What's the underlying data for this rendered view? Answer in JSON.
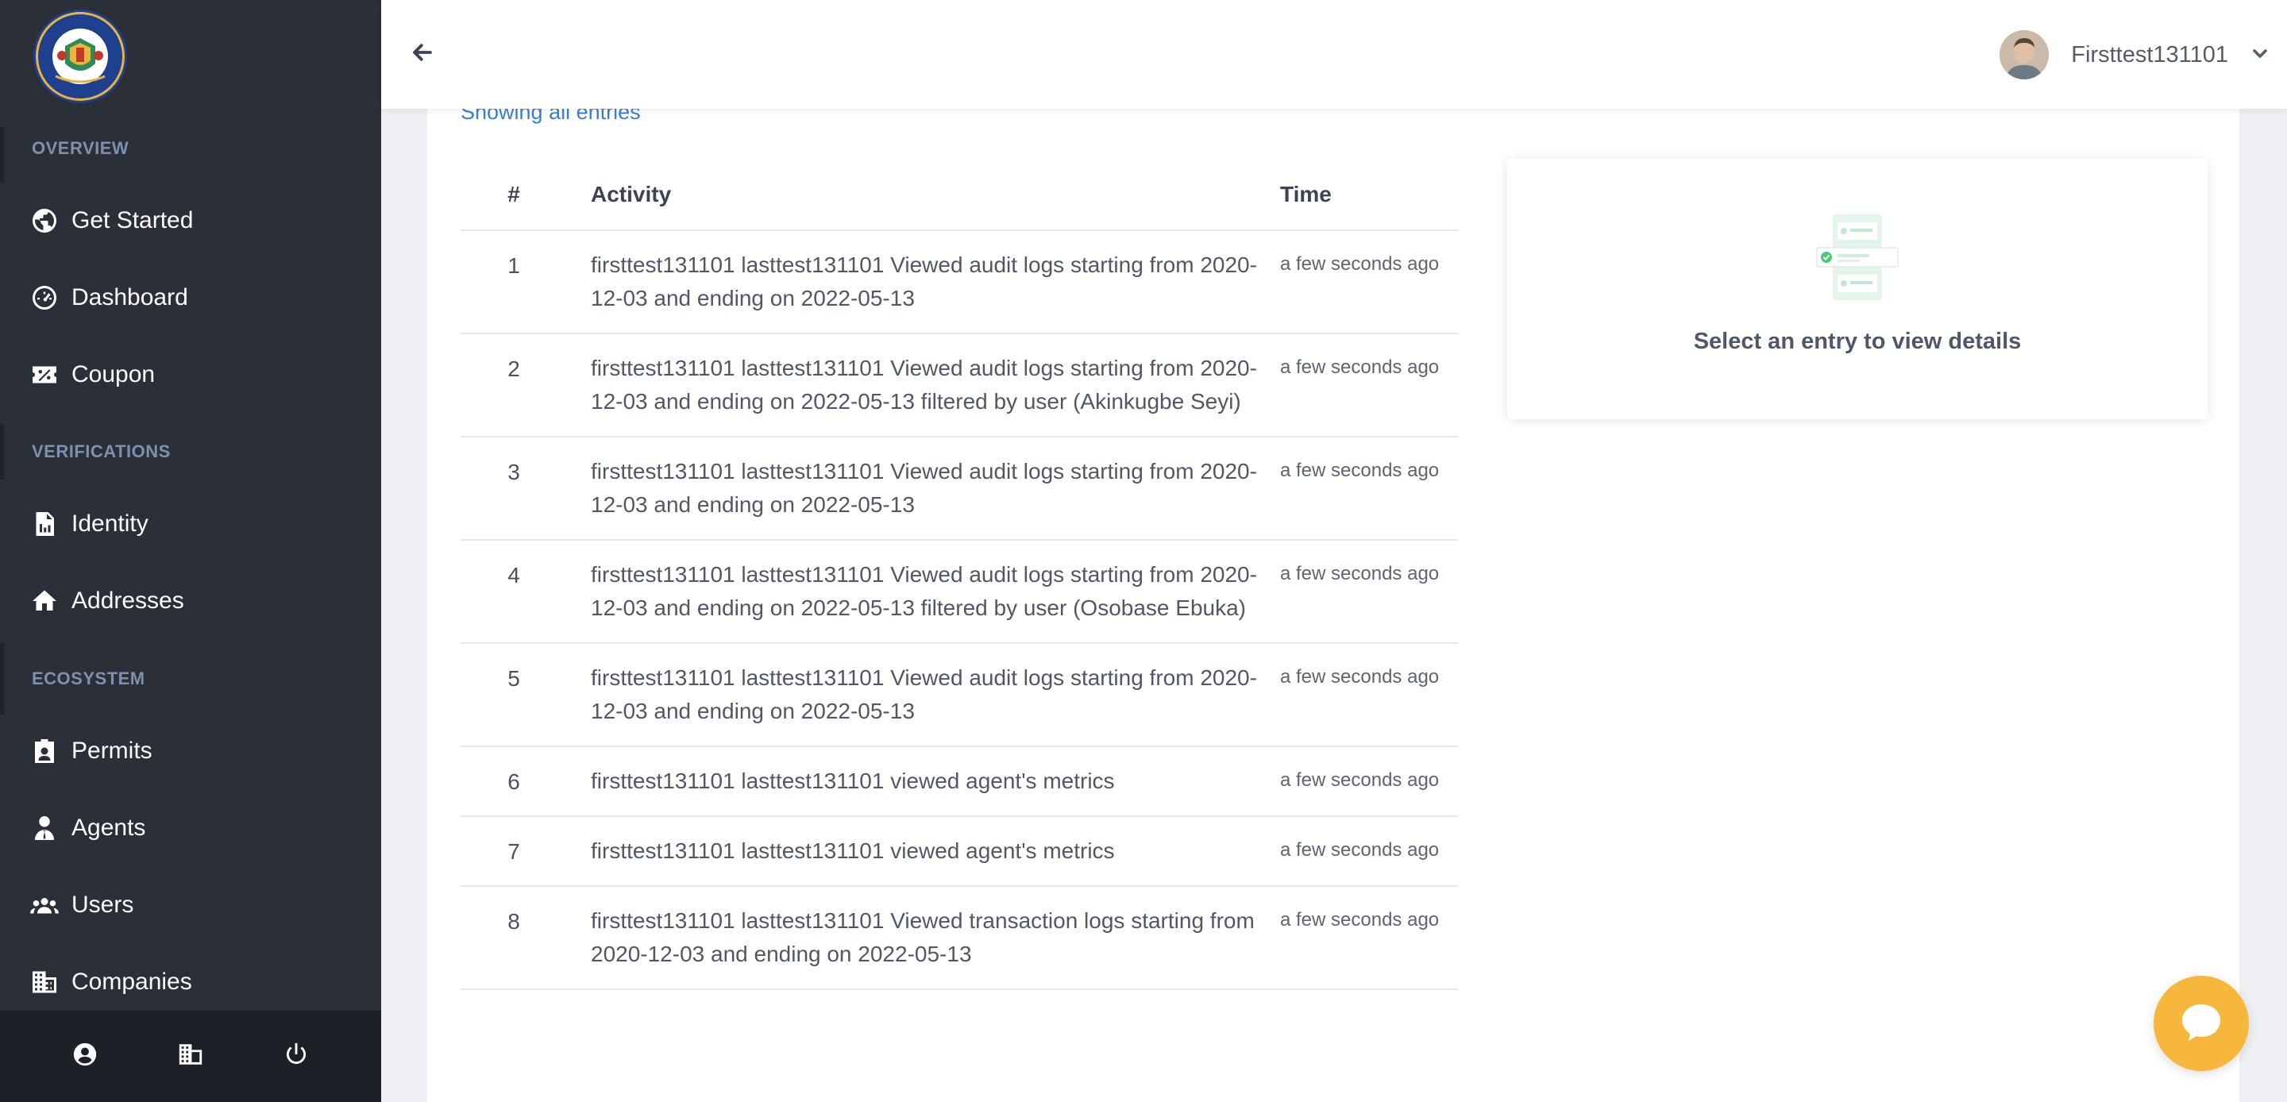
{
  "sidebar": {
    "logo_text": "LAGOS STATE LOTTERIES AND GAMING AUTHORITY",
    "sections": [
      {
        "label": "OVERVIEW"
      },
      {
        "label": "VERIFICATIONS"
      },
      {
        "label": "ECOSYSTEM"
      }
    ],
    "items": [
      {
        "label": "Get Started",
        "icon": "globe-icon"
      },
      {
        "label": "Dashboard",
        "icon": "gauge-icon"
      },
      {
        "label": "Coupon",
        "icon": "coupon-icon"
      },
      {
        "label": "Identity",
        "icon": "id-document-icon"
      },
      {
        "label": "Addresses",
        "icon": "home-icon"
      },
      {
        "label": "Permits",
        "icon": "badge-icon"
      },
      {
        "label": "Agents",
        "icon": "agent-icon"
      },
      {
        "label": "Users",
        "icon": "users-icon"
      },
      {
        "label": "Companies",
        "icon": "building-icon"
      }
    ],
    "footer": [
      "profile-icon",
      "company-icon",
      "power-icon"
    ]
  },
  "header": {
    "user_name": "Firsttest131101"
  },
  "main": {
    "showing_text": "Showing all entries",
    "table": {
      "columns": [
        "#",
        "Activity",
        "Time"
      ],
      "rows": [
        {
          "num": "1",
          "activity": "firsttest131101 lasttest131101 Viewed audit logs starting from 2020-12-03 and ending on 2022-05-13",
          "time": "a few seconds ago"
        },
        {
          "num": "2",
          "activity": "firsttest131101 lasttest131101 Viewed audit logs starting from 2020-12-03 and ending on 2022-05-13 filtered by user (Akinkugbe Seyi)",
          "time": "a few seconds ago"
        },
        {
          "num": "3",
          "activity": "firsttest131101 lasttest131101 Viewed audit logs starting from 2020-12-03 and ending on 2022-05-13",
          "time": "a few seconds ago"
        },
        {
          "num": "4",
          "activity": "firsttest131101 lasttest131101 Viewed audit logs starting from 2020-12-03 and ending on 2022-05-13 filtered by user (Osobase Ebuka)",
          "time": "a few seconds ago"
        },
        {
          "num": "5",
          "activity": "firsttest131101 lasttest131101 Viewed audit logs starting from 2020-12-03 and ending on 2022-05-13",
          "time": "a few seconds ago"
        },
        {
          "num": "6",
          "activity": "firsttest131101 lasttest131101 viewed agent's metrics",
          "time": "a few seconds ago"
        },
        {
          "num": "7",
          "activity": "firsttest131101 lasttest131101 viewed agent's metrics",
          "time": "a few seconds ago"
        },
        {
          "num": "8",
          "activity": "firsttest131101 lasttest131101 Viewed transaction logs starting from 2020-12-03 and ending on 2022-05-13",
          "time": "a few seconds ago"
        }
      ]
    },
    "details": {
      "empty_text": "Select an entry to view details"
    }
  },
  "colors": {
    "sidebar_bg": "#2a2f38",
    "sidebar_footer_bg": "#1c2027",
    "section_label": "#7f8fb0",
    "link_blue": "#3a7fd5",
    "chat_button": "#f7b73c",
    "illustration_green": "#4cc97a"
  }
}
